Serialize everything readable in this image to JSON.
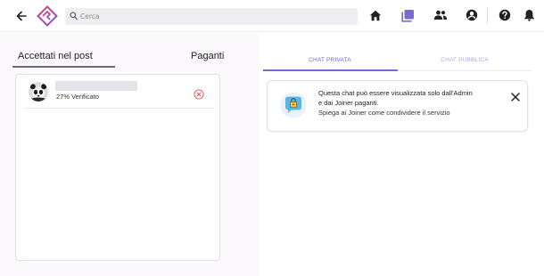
{
  "search": {
    "placeholder": "Cerca"
  },
  "nav": {
    "icons": [
      "back-arrow-icon",
      "logo-icon",
      "home-icon",
      "groups-icon",
      "people-icon",
      "account-icon",
      "help-icon",
      "bell-icon"
    ],
    "active": "groups-icon"
  },
  "members": {
    "tabs": [
      {
        "label": "Accettati nel post",
        "active": true
      },
      {
        "label": "Paganti",
        "active": false
      }
    ],
    "rows": [
      {
        "name": "",
        "status": "27% Verificato"
      }
    ]
  },
  "chat": {
    "tabs": [
      {
        "label": "CHAT PRIVATA",
        "active": true
      },
      {
        "label": "CHAT PUBBLICA",
        "active": false
      }
    ],
    "info": {
      "line1": "Questa chat può essere visualizzata solo dall'Admin",
      "line2": "e dai Joiner paganti.",
      "line3": "Spiega ai Joiner come condividere il servizio"
    }
  },
  "colors": {
    "accent": "#7d68d2",
    "accent_light": "#b3a4e0",
    "remove": "#e0524f",
    "logo_pink": "#e0417a",
    "logo_purple": "#7a57d1"
  }
}
